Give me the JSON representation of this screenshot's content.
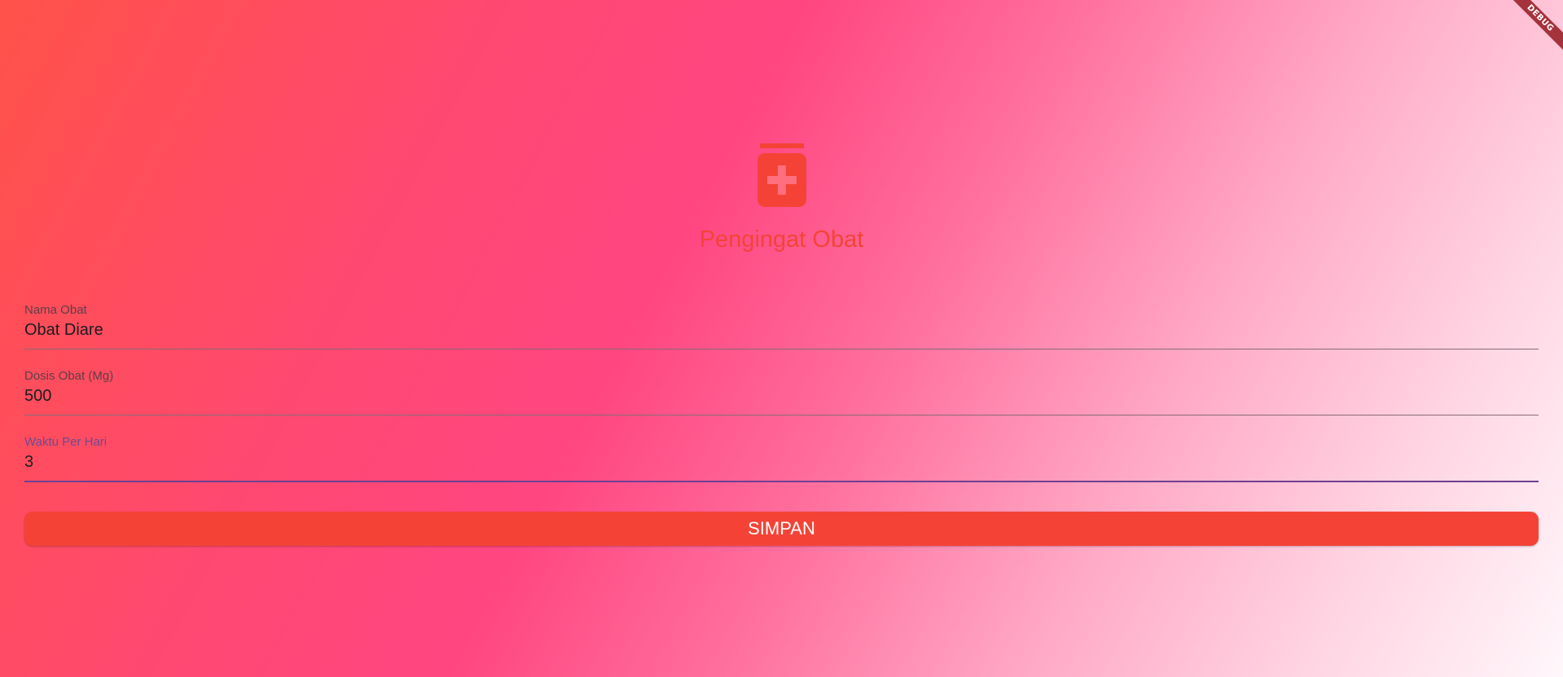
{
  "app": {
    "debug_label": "DEBUG",
    "accent_color": "#f44336"
  },
  "header": {
    "icon": "medicine-bottle-icon",
    "title": "Pengingat Obat"
  },
  "form": {
    "fields": [
      {
        "label": "Nama Obat",
        "value": "Obat Diare"
      },
      {
        "label": "Dosis Obat (Mg)",
        "value": "500"
      },
      {
        "label": "Waktu Per Hari",
        "value": "3"
      }
    ],
    "submit_label": "SIMPAN"
  }
}
